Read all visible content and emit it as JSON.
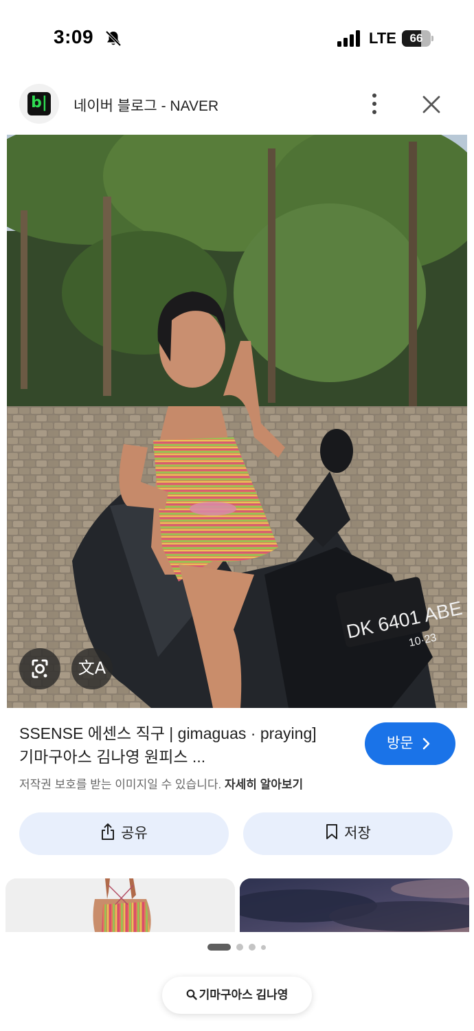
{
  "status_bar": {
    "time": "3:09",
    "network": "LTE",
    "battery": "66",
    "battery_level": 0.66,
    "icons": [
      "bell-muted-icon",
      "signal-icon",
      "battery-icon"
    ]
  },
  "header": {
    "logo_text": "b|",
    "site_name": "네이버 블로그 - NAVER",
    "icons": [
      "more-vertical-icon",
      "close-icon"
    ]
  },
  "image_overlay": {
    "icons": [
      "lens-icon",
      "translate-icon"
    ],
    "translate_glyph": "文A"
  },
  "result": {
    "title_line1": "SSENSE 에센스 직구 | gimaguas · praying]",
    "title_line2": "기마구아스 김나영 원피스 ...",
    "copyright_text": "저작권 보호를 받는 이미지일 수 있습니다.",
    "learn_more": "자세히 알아보기",
    "visit_label": "방문"
  },
  "actions": {
    "share_label": "공유",
    "save_label": "저장"
  },
  "carousel": {
    "page_count": 4,
    "active_index": 0
  },
  "search_chip": {
    "label": "기마구아스 김나영",
    "icon": "search-icon"
  },
  "colors": {
    "accent": "#1a73e8",
    "action_bg": "#e8effc",
    "logo_green": "#2fdc52"
  }
}
